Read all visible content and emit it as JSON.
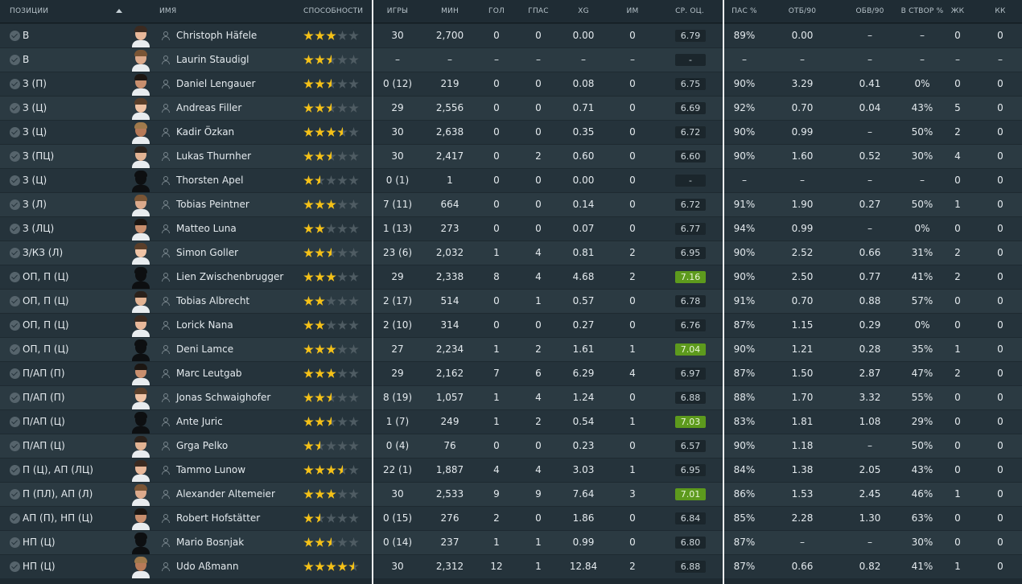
{
  "header": {
    "positions": "ПОЗИЦИИ",
    "name": "ИМЯ",
    "ability": "СПОСОБНОСТИ",
    "apps": "ИГРЫ",
    "mins": "МИН",
    "goals": "ГОЛ",
    "assists": "ГПАС",
    "xg": "XG",
    "pom": "ИМ",
    "avg_rating": "СР. ОЦ.",
    "pass_pct": "ПАС %",
    "tackles90": "ОТБ/90",
    "dribbles90": "ОБВ/90",
    "shots_on_target": "В СТВОР %",
    "yellow": "ЖК",
    "red": "КК"
  },
  "colors": {
    "star": "#f5c117",
    "rating_high": "#5d9a1d",
    "row": "#25333b",
    "row_alt": "#2b3a42"
  },
  "players": [
    {
      "pos": "В",
      "name": "Christoph Häfele",
      "stars": 3,
      "apps": "30",
      "mins": "2,700",
      "gls": "0",
      "ast": "0",
      "xg": "0.00",
      "pom": "0",
      "rating": "6.79",
      "hi": false,
      "pas": "89%",
      "tck": "0.00",
      "drb": "–",
      "sot": "–",
      "yel": "0",
      "red": "0"
    },
    {
      "pos": "В",
      "name": "Laurin Staudigl",
      "stars": 2.5,
      "apps": "–",
      "mins": "–",
      "gls": "–",
      "ast": "–",
      "xg": "–",
      "pom": "–",
      "rating": "-",
      "hi": false,
      "pas": "–",
      "tck": "–",
      "drb": "–",
      "sot": "–",
      "yel": "–",
      "red": "–"
    },
    {
      "pos": "З (П)",
      "name": "Daniel Lengauer",
      "stars": 2.5,
      "apps": "0 (12)",
      "mins": "219",
      "gls": "0",
      "ast": "0",
      "xg": "0.08",
      "pom": "0",
      "rating": "6.75",
      "hi": false,
      "pas": "90%",
      "tck": "3.29",
      "drb": "0.41",
      "sot": "0%",
      "yel": "0",
      "red": "0"
    },
    {
      "pos": "З (Ц)",
      "name": "Andreas Filler",
      "stars": 2.5,
      "apps": "29",
      "mins": "2,556",
      "gls": "0",
      "ast": "0",
      "xg": "0.71",
      "pom": "0",
      "rating": "6.69",
      "hi": false,
      "pas": "92%",
      "tck": "0.70",
      "drb": "0.04",
      "sot": "43%",
      "yel": "5",
      "red": "0"
    },
    {
      "pos": "З (Ц)",
      "name": "Kadir Özkan",
      "stars": 3.5,
      "apps": "30",
      "mins": "2,638",
      "gls": "0",
      "ast": "0",
      "xg": "0.35",
      "pom": "0",
      "rating": "6.72",
      "hi": false,
      "pas": "90%",
      "tck": "0.99",
      "drb": "–",
      "sot": "50%",
      "yel": "2",
      "red": "0"
    },
    {
      "pos": "З (ПЦ)",
      "name": "Lukas Thurnher",
      "stars": 2.5,
      "apps": "30",
      "mins": "2,417",
      "gls": "0",
      "ast": "2",
      "xg": "0.60",
      "pom": "0",
      "rating": "6.60",
      "hi": false,
      "pas": "90%",
      "tck": "1.60",
      "drb": "0.52",
      "sot": "30%",
      "yel": "4",
      "red": "0"
    },
    {
      "pos": "З (Ц)",
      "name": "Thorsten Apel",
      "stars": 1.5,
      "apps": "0 (1)",
      "mins": "1",
      "gls": "0",
      "ast": "0",
      "xg": "0.00",
      "pom": "0",
      "rating": "-",
      "hi": false,
      "pas": "–",
      "tck": "–",
      "drb": "–",
      "sot": "–",
      "yel": "0",
      "red": "0"
    },
    {
      "pos": "З (Л)",
      "name": "Tobias Peintner",
      "stars": 3,
      "apps": "7 (11)",
      "mins": "664",
      "gls": "0",
      "ast": "0",
      "xg": "0.14",
      "pom": "0",
      "rating": "6.72",
      "hi": false,
      "pas": "91%",
      "tck": "1.90",
      "drb": "0.27",
      "sot": "50%",
      "yel": "1",
      "red": "0"
    },
    {
      "pos": "З (ЛЦ)",
      "name": "Matteo Luna",
      "stars": 2,
      "apps": "1 (13)",
      "mins": "273",
      "gls": "0",
      "ast": "0",
      "xg": "0.07",
      "pom": "0",
      "rating": "6.77",
      "hi": false,
      "pas": "94%",
      "tck": "0.99",
      "drb": "–",
      "sot": "0%",
      "yel": "0",
      "red": "0"
    },
    {
      "pos": "З/КЗ (Л)",
      "name": "Simon Goller",
      "stars": 2.5,
      "apps": "23 (6)",
      "mins": "2,032",
      "gls": "1",
      "ast": "4",
      "xg": "0.81",
      "pom": "2",
      "rating": "6.95",
      "hi": false,
      "pas": "90%",
      "tck": "2.52",
      "drb": "0.66",
      "sot": "31%",
      "yel": "2",
      "red": "0"
    },
    {
      "pos": "ОП, П (Ц)",
      "name": "Lien Zwischenbrugger",
      "stars": 3,
      "apps": "29",
      "mins": "2,338",
      "gls": "8",
      "ast": "4",
      "xg": "4.68",
      "pom": "2",
      "rating": "7.16",
      "hi": true,
      "pas": "90%",
      "tck": "2.50",
      "drb": "0.77",
      "sot": "41%",
      "yel": "2",
      "red": "0"
    },
    {
      "pos": "ОП, П (Ц)",
      "name": "Tobias Albrecht",
      "stars": 2,
      "apps": "2 (17)",
      "mins": "514",
      "gls": "0",
      "ast": "1",
      "xg": "0.57",
      "pom": "0",
      "rating": "6.78",
      "hi": false,
      "pas": "91%",
      "tck": "0.70",
      "drb": "0.88",
      "sot": "57%",
      "yel": "0",
      "red": "0"
    },
    {
      "pos": "ОП, П (Ц)",
      "name": "Lorick Nana",
      "stars": 2,
      "apps": "2 (10)",
      "mins": "314",
      "gls": "0",
      "ast": "0",
      "xg": "0.27",
      "pom": "0",
      "rating": "6.76",
      "hi": false,
      "pas": "87%",
      "tck": "1.15",
      "drb": "0.29",
      "sot": "0%",
      "yel": "0",
      "red": "0"
    },
    {
      "pos": "ОП, П (Ц)",
      "name": "Deni Lamce",
      "stars": 3,
      "apps": "27",
      "mins": "2,234",
      "gls": "1",
      "ast": "2",
      "xg": "1.61",
      "pom": "1",
      "rating": "7.04",
      "hi": true,
      "pas": "90%",
      "tck": "1.21",
      "drb": "0.28",
      "sot": "35%",
      "yel": "1",
      "red": "0"
    },
    {
      "pos": "П/АП (П)",
      "name": "Marc Leutgab",
      "stars": 3,
      "apps": "29",
      "mins": "2,162",
      "gls": "7",
      "ast": "6",
      "xg": "6.29",
      "pom": "4",
      "rating": "6.97",
      "hi": false,
      "pas": "87%",
      "tck": "1.50",
      "drb": "2.87",
      "sot": "47%",
      "yel": "2",
      "red": "0"
    },
    {
      "pos": "П/АП (П)",
      "name": "Jonas Schwaighofer",
      "stars": 2.5,
      "apps": "8 (19)",
      "mins": "1,057",
      "gls": "1",
      "ast": "4",
      "xg": "1.24",
      "pom": "0",
      "rating": "6.88",
      "hi": false,
      "pas": "88%",
      "tck": "1.70",
      "drb": "3.32",
      "sot": "55%",
      "yel": "0",
      "red": "0"
    },
    {
      "pos": "П/АП (Ц)",
      "name": "Ante Juric",
      "stars": 2.5,
      "apps": "1 (7)",
      "mins": "249",
      "gls": "1",
      "ast": "2",
      "xg": "0.54",
      "pom": "1",
      "rating": "7.03",
      "hi": true,
      "pas": "83%",
      "tck": "1.81",
      "drb": "1.08",
      "sot": "29%",
      "yel": "0",
      "red": "0"
    },
    {
      "pos": "П/АП (Ц)",
      "name": "Grga Pelko",
      "stars": 1.5,
      "apps": "0 (4)",
      "mins": "76",
      "gls": "0",
      "ast": "0",
      "xg": "0.23",
      "pom": "0",
      "rating": "6.57",
      "hi": false,
      "pas": "90%",
      "tck": "1.18",
      "drb": "–",
      "sot": "50%",
      "yel": "0",
      "red": "0"
    },
    {
      "pos": "П (Ц), АП (ЛЦ)",
      "name": "Tammo Lunow",
      "stars": 3.5,
      "apps": "22 (1)",
      "mins": "1,887",
      "gls": "4",
      "ast": "4",
      "xg": "3.03",
      "pom": "1",
      "rating": "6.95",
      "hi": false,
      "pas": "84%",
      "tck": "1.38",
      "drb": "2.05",
      "sot": "43%",
      "yel": "0",
      "red": "0"
    },
    {
      "pos": "П (ПЛ), АП (Л)",
      "name": "Alexander Altemeier",
      "stars": 3,
      "apps": "30",
      "mins": "2,533",
      "gls": "9",
      "ast": "9",
      "xg": "7.64",
      "pom": "3",
      "rating": "7.01",
      "hi": true,
      "pas": "86%",
      "tck": "1.53",
      "drb": "2.45",
      "sot": "46%",
      "yel": "1",
      "red": "0"
    },
    {
      "pos": "АП (П), НП (Ц)",
      "name": "Robert Hofstätter",
      "stars": 1.5,
      "apps": "0 (15)",
      "mins": "276",
      "gls": "2",
      "ast": "0",
      "xg": "1.86",
      "pom": "0",
      "rating": "6.84",
      "hi": false,
      "pas": "85%",
      "tck": "2.28",
      "drb": "1.30",
      "sot": "63%",
      "yel": "0",
      "red": "0"
    },
    {
      "pos": "НП (Ц)",
      "name": "Mario Bosnjak",
      "stars": 2.5,
      "apps": "0 (14)",
      "mins": "237",
      "gls": "1",
      "ast": "1",
      "xg": "0.99",
      "pom": "0",
      "rating": "6.80",
      "hi": false,
      "pas": "87%",
      "tck": "–",
      "drb": "–",
      "sot": "30%",
      "yel": "0",
      "red": "0"
    },
    {
      "pos": "НП (Ц)",
      "name": "Udo Aßmann",
      "stars": 4.5,
      "apps": "30",
      "mins": "2,312",
      "gls": "12",
      "ast": "1",
      "xg": "12.84",
      "pom": "2",
      "rating": "6.88",
      "hi": false,
      "pas": "87%",
      "tck": "0.66",
      "drb": "0.82",
      "sot": "41%",
      "yel": "1",
      "red": "0"
    }
  ]
}
